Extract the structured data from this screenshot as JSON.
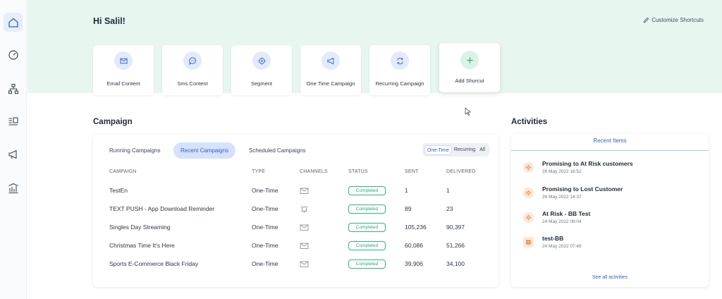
{
  "greeting": "Hi Salil!",
  "customize_label": "Customize Shortcuts",
  "shortcuts": [
    {
      "label": "Email Content",
      "icon": "mail-icon"
    },
    {
      "label": "Sms Content",
      "icon": "chat-icon"
    },
    {
      "label": "Segment",
      "icon": "target-icon"
    },
    {
      "label": "One Time Campaign",
      "icon": "megaphone-icon"
    },
    {
      "label": "Recurring Campaign",
      "icon": "recurring-icon"
    },
    {
      "label": "Add Shorcut",
      "icon": "plus-icon"
    }
  ],
  "campaign": {
    "title": "Campaign",
    "tabs": [
      "Running Campaigns",
      "Recent Campaigns",
      "Scheduled Campaigns"
    ],
    "active_tab": "Recent Campaigns",
    "type_filter": {
      "options": [
        "One-Time",
        "Recurring",
        "All"
      ],
      "selected": "One-Time"
    },
    "columns": [
      "CAMPAIGN",
      "TYPE",
      "CHANNELS",
      "STATUS",
      "SENT",
      "DELIVERED"
    ],
    "rows": [
      {
        "name": "TestEn",
        "type": "One-Time",
        "channel": "email-icon",
        "status": "Completed",
        "sent": "1",
        "delivered": "1"
      },
      {
        "name": "TEXT PUSH - App Download Reminder",
        "type": "One-Time",
        "channel": "push-icon",
        "status": "Completed",
        "sent": "89",
        "delivered": "23"
      },
      {
        "name": "Singles Day Streaming",
        "type": "One-Time",
        "channel": "email-icon",
        "status": "Completed",
        "sent": "105,236",
        "delivered": "90,397"
      },
      {
        "name": "Christmas Time It's Here",
        "type": "One-Time",
        "channel": "email-icon",
        "status": "Completed",
        "sent": "60,086",
        "delivered": "51,266"
      },
      {
        "name": "Sports E-Commerce Black Friday",
        "type": "One-Time",
        "channel": "email-icon",
        "status": "Completed",
        "sent": "39,906",
        "delivered": "34,100"
      }
    ]
  },
  "activities": {
    "title": "Activities",
    "tab": "Recent Items",
    "items": [
      {
        "title": "Promising to At Risk customers",
        "date": "26 May 2022 16:52",
        "icon": "segment-icon"
      },
      {
        "title": "Promising to Lost Customer",
        "date": "26 May 2022 14:37",
        "icon": "segment-icon"
      },
      {
        "title": "At Risk - BB Test",
        "date": "24 May 2022 08:04",
        "icon": "segment-icon"
      },
      {
        "title": "test-BB",
        "date": "24 May 2022 07:49",
        "icon": "content-icon"
      }
    ],
    "see_all": "See all activities"
  },
  "colors": {
    "accent": "#2f5fd0",
    "hero_bg": "#e7f7f0",
    "success": "#2fb57c",
    "activity_icon": "#e8884d"
  }
}
